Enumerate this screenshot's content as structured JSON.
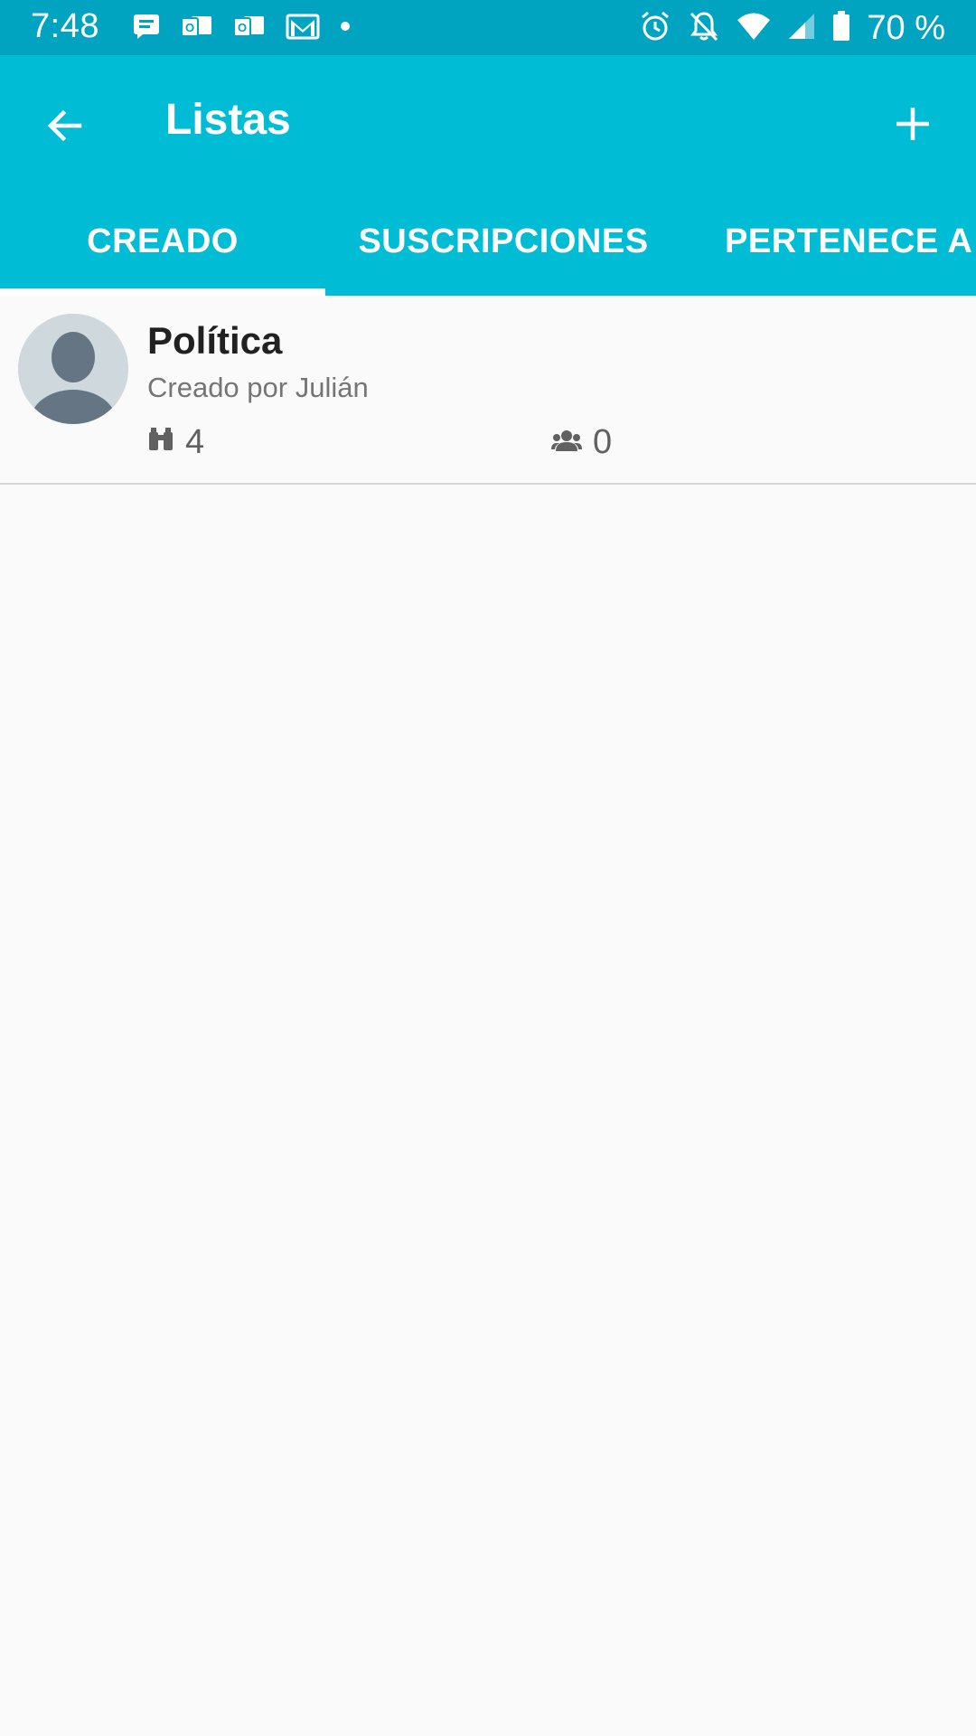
{
  "status_bar": {
    "time": "7:48",
    "battery": "70 %",
    "left_icons": [
      "message-icon",
      "outlook-icon",
      "outlook-icon",
      "gmail-icon",
      "dot-icon"
    ],
    "right_icons": [
      "alarm-icon",
      "notifications-off-icon",
      "wifi-icon",
      "signal-icon",
      "battery-icon"
    ]
  },
  "toolbar": {
    "title": "Listas",
    "back_icon": "arrow-back-icon",
    "add_icon": "add-icon"
  },
  "tabs": [
    {
      "label": "CREADO",
      "selected": true
    },
    {
      "label": "SUSCRIPCIONES",
      "selected": false
    },
    {
      "label": "PERTENECE A",
      "selected": false
    }
  ],
  "lists": [
    {
      "title": "Política",
      "subtitle": "Creado por Julián",
      "followers_icon": "binoculars-icon",
      "followers": "4",
      "members_icon": "group-icon",
      "members": "0"
    }
  ],
  "colors": {
    "status_bar": "#00a4c0",
    "app_bar": "#00bcd4",
    "background": "#fafafa",
    "tab_indicator": "#ffffff"
  }
}
